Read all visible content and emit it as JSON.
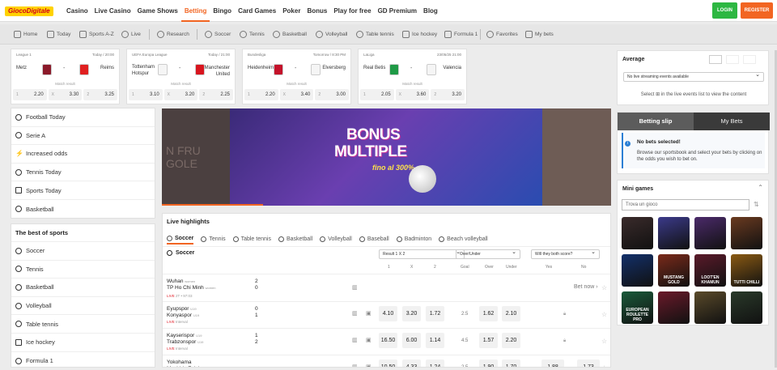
{
  "brand": {
    "logo_text": "GiocoDigitale"
  },
  "menu": [
    "Casino",
    "Live Casino",
    "Game Shows",
    "Betting",
    "Bingo",
    "Card Games",
    "Poker",
    "Bonus",
    "Play for free",
    "GD Premium",
    "Blog"
  ],
  "menu_active": "Betting",
  "auth": {
    "login": "LOGIN",
    "register": "REGISTER"
  },
  "subnav": [
    "Home",
    "Today",
    "Sports A-Z",
    "Live",
    "Research",
    "Soccer",
    "Tennis",
    "Basketball",
    "Volleyball",
    "Table tennis",
    "Ice hockey",
    "Formula 1",
    "Favorites",
    "My bets"
  ],
  "matches": [
    {
      "league": "League 1",
      "date": "Today / 20:00",
      "home": "Metz",
      "away": "Reims",
      "label": "Match result",
      "odds": [
        [
          "1",
          "2.20"
        ],
        [
          "X",
          "3.30"
        ],
        [
          "2",
          "3.25"
        ]
      ],
      "home_color": "#8b1a2a",
      "away_color": "#e02020"
    },
    {
      "league": "UEFA Europa League",
      "date": "Today / 21:00",
      "home": "Tottenham Hotspur",
      "away": "Manchester United",
      "label": "Match result",
      "odds": [
        [
          "1",
          "3.10"
        ],
        [
          "X",
          "3.20"
        ],
        [
          "2",
          "2.25"
        ]
      ],
      "home_color": "#f5f5f5",
      "away_color": "#d8151e"
    },
    {
      "league": "Bundesliga",
      "date": "Tomorrow / 8:30 PM",
      "home": "Heidenheim",
      "away": "Elversberg",
      "label": "Match result",
      "odds": [
        [
          "1",
          "2.20"
        ],
        [
          "X",
          "3.40"
        ],
        [
          "2",
          "3.00"
        ]
      ],
      "home_color": "#c4122a",
      "away_color": "#f5f5f5"
    },
    {
      "league": "LaLiga",
      "date": "23/05/25 21:00",
      "home": "Real Betis",
      "away": "Valencia",
      "label": "Match result",
      "odds": [
        [
          "1",
          "2.05"
        ],
        [
          "X",
          "3.60"
        ],
        [
          "2",
          "3.20"
        ]
      ],
      "home_color": "#1f9a46",
      "away_color": "#f5f5f5"
    }
  ],
  "quick_links": [
    "Football Today",
    "Serie A",
    "Increased odds",
    "Tennis Today",
    "Sports Today",
    "Basketball"
  ],
  "best_sports": {
    "title": "The best of sports",
    "items": [
      "Soccer",
      "Tennis",
      "Basketball",
      "Volleyball",
      "Table tennis",
      "Ice hockey",
      "Formula 1"
    ]
  },
  "banner": {
    "line1": "BONUS",
    "line2": "MULTIPLE",
    "line3": "fino al 300%",
    "ghost1": "N FRU",
    "ghost2": "GOLE"
  },
  "live": {
    "title": "Live highlights",
    "tabs": [
      "Soccer",
      "Tennis",
      "Table tennis",
      "Basketball",
      "Volleyball",
      "Baseball",
      "Badminton",
      "Beach volleyball"
    ],
    "section": "Soccer",
    "markets": [
      "Result 1 X 2",
      "Over/Under",
      "Will they both score?"
    ],
    "cols": [
      "1",
      "X",
      "2",
      "Goal",
      "Over",
      "Under",
      "Yes",
      "No"
    ],
    "rows": [
      {
        "home": "Wuhan",
        "home_tag": "women",
        "away": "TP Ho Chi Minh",
        "away_tag": "women",
        "live": "LIVE",
        "status": "2T • 97:03",
        "score": [
          "2",
          "0"
        ],
        "betnow": "Bet now"
      },
      {
        "home": "Eyupspor",
        "home_tag": "U19",
        "away": "Konyaspor",
        "away_tag": "U19",
        "live": "LIVE",
        "status": "Interval",
        "score": [
          "0",
          "1"
        ],
        "odds": [
          "4.10",
          "3.20",
          "1.72"
        ],
        "goal": "2.5",
        "ou": [
          "1.62",
          "2.10"
        ]
      },
      {
        "home": "Kayserispor",
        "home_tag": "U19",
        "away": "Trabzonspor",
        "away_tag": "U19",
        "live": "LIVE",
        "status": "Interval",
        "score": [
          "1",
          "2"
        ],
        "odds": [
          "16.50",
          "6.00",
          "1.14"
        ],
        "goal": "4.5",
        "ou": [
          "1.57",
          "2.20"
        ]
      },
      {
        "home": "Yokohama",
        "home_tag": "",
        "away": "Machida Zelvia",
        "away_tag": "",
        "score": [
          "",
          ""
        ],
        "odds": [
          "10.50",
          "4.33",
          "1.24"
        ],
        "goal": "2.5",
        "ou": [
          "1.90",
          "1.70"
        ],
        "yn": [
          "1.88",
          "1.73"
        ]
      }
    ]
  },
  "average": {
    "title": "Average",
    "select": "No live streaming events available",
    "msg": "Select ⊞ in the live events list to view the content"
  },
  "slip": {
    "tab1": "Betting slip",
    "tab2": "My Bets",
    "no_bets": "No bets selected!",
    "desc": "Browse our sportsbook and select your bets by clicking on the odds you wish to bet on."
  },
  "mini": {
    "title": "Mini games",
    "search": "Trova un gioco",
    "games": [
      {
        "name": "",
        "color": "#3a2b2b"
      },
      {
        "name": "",
        "color": "#3b3a8a"
      },
      {
        "name": "",
        "color": "#4b2a6a"
      },
      {
        "name": "",
        "color": "#6a3a20"
      },
      {
        "name": "",
        "color": "#12306a"
      },
      {
        "name": "MUSTANG GOLD",
        "color": "#7a2a1a"
      },
      {
        "name": "LOOT'EN KHAMUN",
        "color": "#5a1a2a"
      },
      {
        "name": "TUTTI CHILLI",
        "color": "#8a5a12"
      },
      {
        "name": "EUROPEAN ROULETTE PRO",
        "color": "#1a5a3a"
      },
      {
        "name": "",
        "color": "#6a1a2a"
      },
      {
        "name": "",
        "color": "#5a4a2a"
      },
      {
        "name": "",
        "color": "#2a3a2a"
      }
    ]
  }
}
